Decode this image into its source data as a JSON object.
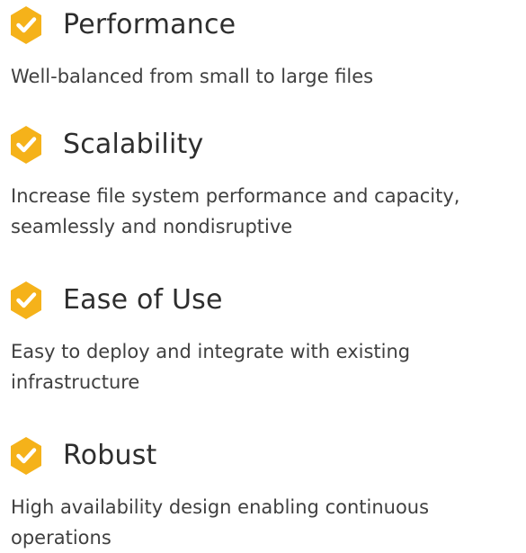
{
  "colors": {
    "badge": "#F5B21A",
    "check": "#FFFFFF",
    "title": "#2E2E2E",
    "text": "#3F3F3F"
  },
  "features": [
    {
      "icon": "hexagon-check-icon",
      "title": "Performance",
      "description": "Well-balanced from small to large files"
    },
    {
      "icon": "hexagon-check-icon",
      "title": "Scalability",
      "description": "Increase file system performance and capacity, seamlessly and nondisruptive"
    },
    {
      "icon": "hexagon-check-icon",
      "title": "Ease of Use",
      "description": "Easy to deploy and integrate with existing infrastructure"
    },
    {
      "icon": "hexagon-check-icon",
      "title": "Robust",
      "description": "High availability design enabling continuous operations"
    }
  ]
}
